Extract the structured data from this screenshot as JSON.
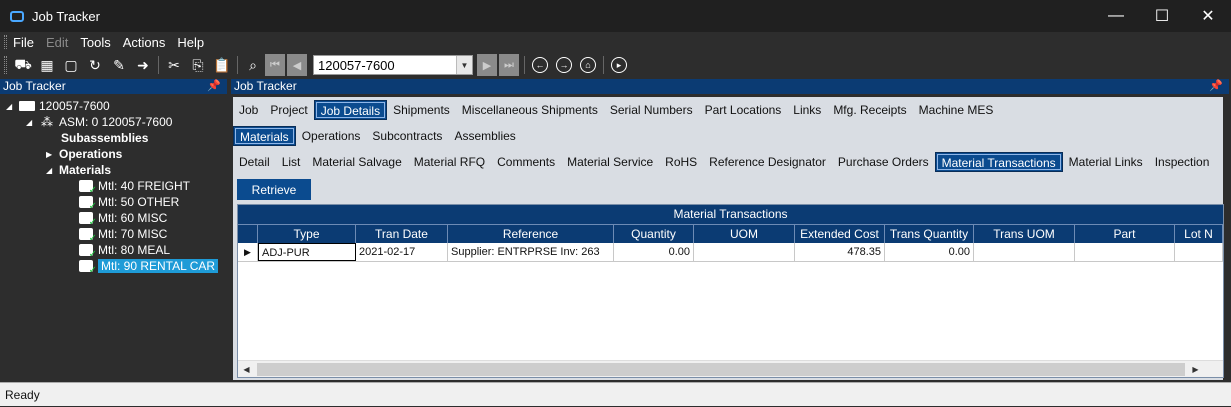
{
  "window": {
    "title": "Job Tracker",
    "minimize": "—",
    "maximize": "☐",
    "close": "✕"
  },
  "menu": [
    "File",
    "Edit",
    "Tools",
    "Actions",
    "Help"
  ],
  "toolbar": {
    "job_value": "120057-7600"
  },
  "left_panel": {
    "title": "Job Tracker",
    "tree": {
      "root": "120057-7600",
      "asm": "ASM: 0 120057-7600",
      "subassemblies": "Subassemblies",
      "operations": "Operations",
      "materials": "Materials",
      "items": [
        "Mtl: 40 FREIGHT",
        "Mtl: 50 OTHER",
        "Mtl: 60 MISC",
        "Mtl: 70 MISC",
        "Mtl: 80 MEAL",
        "Mtl: 90 RENTAL CAR"
      ]
    }
  },
  "right_panel": {
    "title": "Job Tracker",
    "tabs_row1": [
      "Job",
      "Project",
      "Job Details",
      "Shipments",
      "Miscellaneous Shipments",
      "Serial Numbers",
      "Part Locations",
      "Links",
      "Mfg. Receipts",
      "Machine MES"
    ],
    "tabs_row2": [
      "Materials",
      "Operations",
      "Subcontracts",
      "Assemblies"
    ],
    "tabs_row3": [
      "Detail",
      "List",
      "Material Salvage",
      "Material RFQ",
      "Comments",
      "Material Service",
      "RoHS",
      "Reference Designator",
      "Purchase Orders",
      "Material Transactions",
      "Material Links",
      "Inspection"
    ],
    "retrieve_label": "Retrieve",
    "grid": {
      "title": "Material Transactions",
      "columns": [
        "Type",
        "Tran Date",
        "Reference",
        "Quantity",
        "UOM",
        "Extended Cost",
        "Trans Quantity",
        "Trans UOM",
        "Part",
        "Lot N"
      ],
      "rows": [
        {
          "type": "ADJ-PUR",
          "tran_date": "2021-02-17",
          "reference": "Supplier: ENTRPRSE Inv: 263",
          "quantity": "0.00",
          "uom": "",
          "extended_cost": "478.35",
          "trans_quantity": "0.00",
          "trans_uom": "",
          "part": "",
          "lot": ""
        }
      ]
    }
  },
  "status": "Ready"
}
